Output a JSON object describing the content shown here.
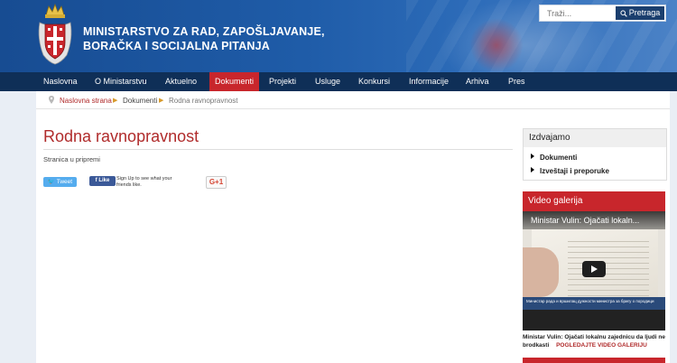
{
  "header": {
    "ministry_line1": "MINISTARSTVO ZA RAD, ZAPOŠLJAVANJE,",
    "ministry_line2": "BORAČKA I SOCIJALNA PITANJA",
    "search_placeholder": "Traži...",
    "search_button": "Pretraga"
  },
  "nav": {
    "items": [
      "Naslovna",
      "O Ministarstvu",
      "Aktuelno",
      "Dokumenti",
      "Projekti",
      "Usluge",
      "Konkursi",
      "Informacije",
      "Arhiva",
      "Pres"
    ],
    "active": "Dokumenti"
  },
  "breadcrumb": [
    "Naslovna strana",
    "Dokumenti",
    "Rodna ravnopravnost"
  ],
  "main": {
    "title": "Rodna ravnopravnost",
    "status": "Stranica u pripremi"
  },
  "social": {
    "tweet": "Tweet",
    "like": "Like",
    "fb_text": "Sign Up to see what your friends like.",
    "gplus": "G+1"
  },
  "sidebar": {
    "izdvajamo_title": "Izdvajamo",
    "links": [
      "Dokumenti",
      "Izveštaji i preporuke"
    ],
    "video_title": "Video galerija",
    "video_overlay_title": "Ministar Vulin: Ojačati lokaln...",
    "video_band_text": "Министар рада и вршилац дужности министра за бригу о породици",
    "video_caption": "Ministar Vulin: Ojačati lokalnu zajednicu da ljudi ne brodkasti",
    "gallery_link": "POGLEDAJTE VIDEO GALERIJU"
  },
  "colors": {
    "header_blue": "#1f5ca8",
    "nav_dark": "#0f2f57",
    "accent_red": "#c8262c",
    "title_red": "#b02b2b"
  }
}
